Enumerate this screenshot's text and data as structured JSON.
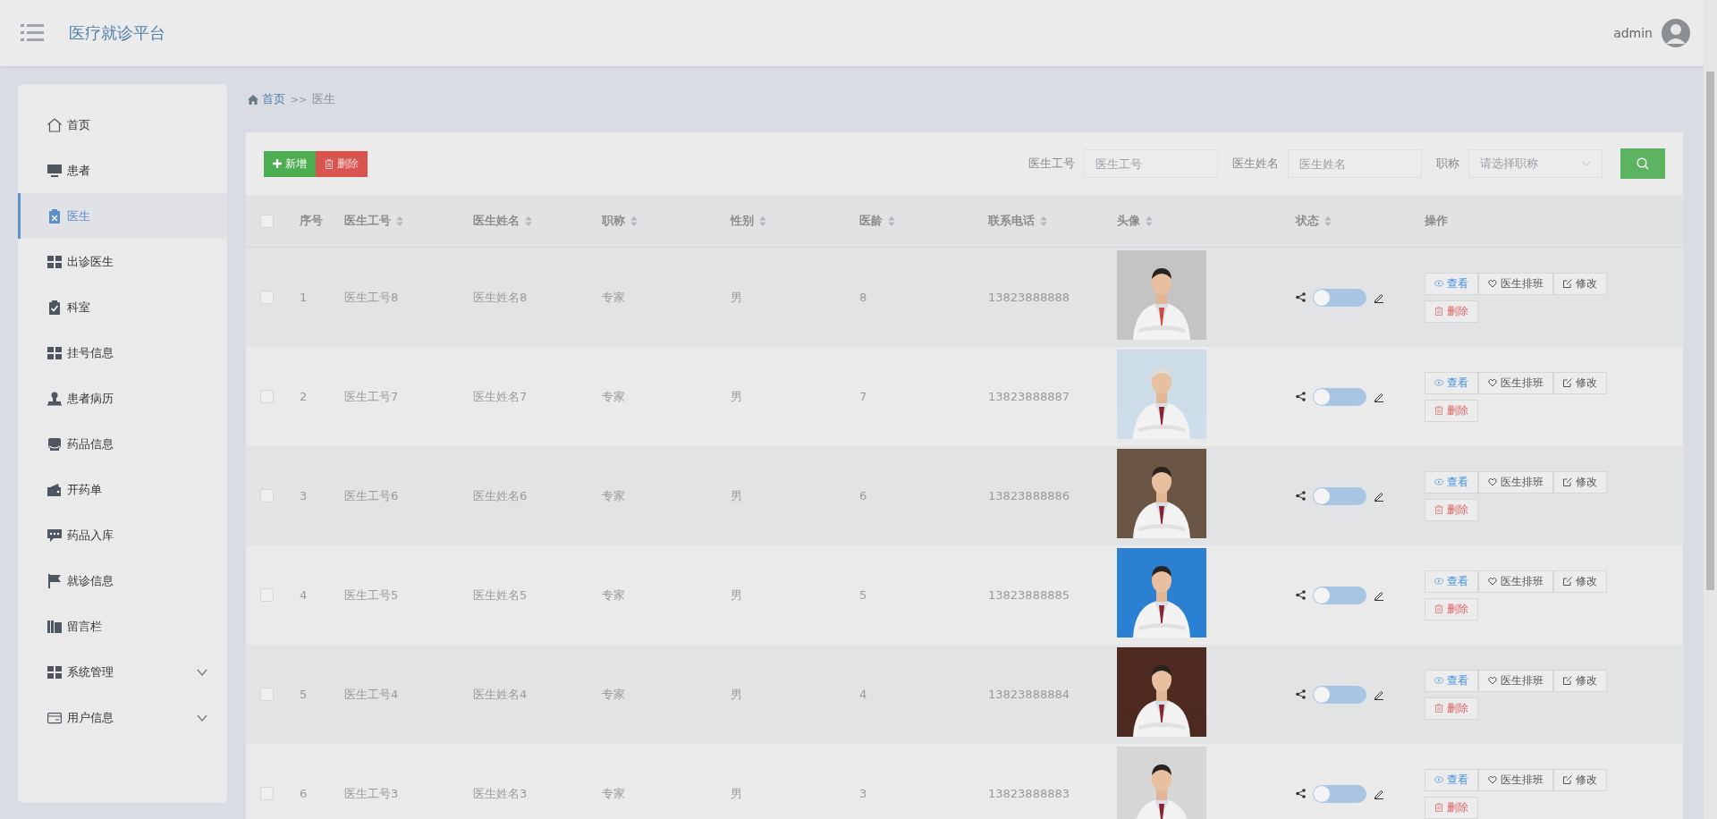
{
  "header": {
    "title": "医疗就诊平台",
    "user": "admin"
  },
  "sidebar": {
    "items": [
      {
        "label": "首页",
        "kind": "link",
        "selected": false
      },
      {
        "label": "患者",
        "kind": "link",
        "selected": false
      },
      {
        "label": "医生",
        "kind": "link",
        "selected": true
      },
      {
        "label": "出诊医生",
        "kind": "link",
        "selected": false
      },
      {
        "label": "科室",
        "kind": "link",
        "selected": false
      },
      {
        "label": "挂号信息",
        "kind": "link",
        "selected": false
      },
      {
        "label": "患者病历",
        "kind": "link",
        "selected": false
      },
      {
        "label": "药品信息",
        "kind": "link",
        "selected": false
      },
      {
        "label": "开药单",
        "kind": "link",
        "selected": false
      },
      {
        "label": "药品入库",
        "kind": "link",
        "selected": false
      },
      {
        "label": "就诊信息",
        "kind": "link",
        "selected": false
      },
      {
        "label": "留言栏",
        "kind": "link",
        "selected": false
      },
      {
        "label": "系统管理",
        "kind": "submenu",
        "selected": false,
        "expanded": false
      },
      {
        "label": "用户信息",
        "kind": "submenu",
        "selected": false,
        "expanded": false
      }
    ]
  },
  "breadcrumb": {
    "separator": ">>",
    "items": [
      {
        "label": "首页",
        "kind": "link"
      },
      {
        "label": "医生",
        "kind": "current"
      }
    ]
  },
  "toolbar": {
    "buttons": [
      {
        "label": "新增",
        "kind": "add"
      },
      {
        "label": "删除",
        "kind": "delete"
      }
    ],
    "filters": [
      {
        "label": "医生工号",
        "placeholder": "医生工号",
        "kind": "text"
      },
      {
        "label": "医生姓名",
        "placeholder": "医生姓名",
        "kind": "text"
      },
      {
        "label": "职称",
        "placeholder": "请选择职称",
        "kind": "select"
      }
    ]
  },
  "table": {
    "all_checked": false,
    "columns": [
      {
        "label": "序号",
        "sortable": false
      },
      {
        "label": "医生工号",
        "sortable": true
      },
      {
        "label": "医生姓名",
        "sortable": true
      },
      {
        "label": "职称",
        "sortable": true
      },
      {
        "label": "性别",
        "sortable": true
      },
      {
        "label": "医龄",
        "sortable": true
      },
      {
        "label": "联系电话",
        "sortable": true
      },
      {
        "label": "头像",
        "sortable": true
      },
      {
        "label": "状态",
        "sortable": true
      },
      {
        "label": "操作",
        "sortable": false
      }
    ],
    "rows": [
      {
        "checked": false,
        "index": "1",
        "doctor_id": "医生工号8",
        "doctor_name": "医生姓名8",
        "title": "专家",
        "gender": "男",
        "years": "8",
        "phone": "13823888888",
        "status_on": false,
        "actions": [
          {
            "label": "查看",
            "kind": "view"
          },
          {
            "label": "医生排班",
            "kind": "schedule"
          },
          {
            "label": "修改",
            "kind": "edit"
          },
          {
            "label": "删除",
            "kind": "delete"
          }
        ]
      },
      {
        "checked": false,
        "index": "2",
        "doctor_id": "医生工号7",
        "doctor_name": "医生姓名7",
        "title": "专家",
        "gender": "男",
        "years": "7",
        "phone": "13823888887",
        "status_on": false,
        "actions": [
          {
            "label": "查看",
            "kind": "view"
          },
          {
            "label": "医生排班",
            "kind": "schedule"
          },
          {
            "label": "修改",
            "kind": "edit"
          },
          {
            "label": "删除",
            "kind": "delete"
          }
        ]
      },
      {
        "checked": false,
        "index": "3",
        "doctor_id": "医生工号6",
        "doctor_name": "医生姓名6",
        "title": "专家",
        "gender": "男",
        "years": "6",
        "phone": "13823888886",
        "status_on": false,
        "actions": [
          {
            "label": "查看",
            "kind": "view"
          },
          {
            "label": "医生排班",
            "kind": "schedule"
          },
          {
            "label": "修改",
            "kind": "edit"
          },
          {
            "label": "删除",
            "kind": "delete"
          }
        ]
      },
      {
        "checked": false,
        "index": "4",
        "doctor_id": "医生工号5",
        "doctor_name": "医生姓名5",
        "title": "专家",
        "gender": "男",
        "years": "5",
        "phone": "13823888885",
        "status_on": false,
        "actions": [
          {
            "label": "查看",
            "kind": "view"
          },
          {
            "label": "医生排班",
            "kind": "schedule"
          },
          {
            "label": "修改",
            "kind": "edit"
          },
          {
            "label": "删除",
            "kind": "delete"
          }
        ]
      },
      {
        "checked": false,
        "index": "5",
        "doctor_id": "医生工号4",
        "doctor_name": "医生姓名4",
        "title": "专家",
        "gender": "男",
        "years": "4",
        "phone": "13823888884",
        "status_on": false,
        "actions": [
          {
            "label": "查看",
            "kind": "view"
          },
          {
            "label": "医生排班",
            "kind": "schedule"
          },
          {
            "label": "修改",
            "kind": "edit"
          },
          {
            "label": "删除",
            "kind": "delete"
          }
        ]
      },
      {
        "checked": false,
        "index": "6",
        "doctor_id": "医生工号3",
        "doctor_name": "医生姓名3",
        "title": "专家",
        "gender": "男",
        "years": "3",
        "phone": "13823888883",
        "status_on": false,
        "actions": [
          {
            "label": "查看",
            "kind": "view"
          },
          {
            "label": "医生排班",
            "kind": "schedule"
          },
          {
            "label": "修改",
            "kind": "edit"
          },
          {
            "label": "删除",
            "kind": "delete"
          }
        ]
      }
    ]
  }
}
